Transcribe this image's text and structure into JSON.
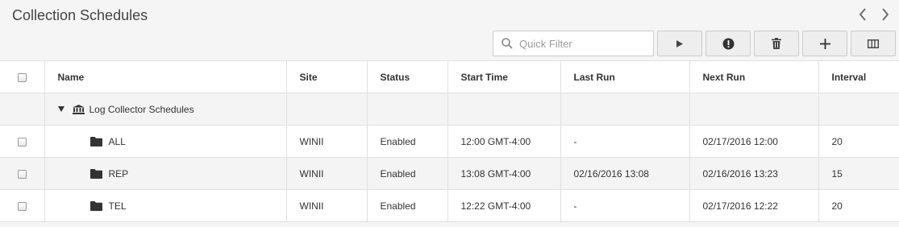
{
  "header": {
    "title": "Collection Schedules"
  },
  "toolbar": {
    "search_placeholder": "Quick Filter"
  },
  "table": {
    "columns": [
      "Name",
      "Site",
      "Status",
      "Start Time",
      "Last Run",
      "Next Run",
      "Interval"
    ],
    "group": {
      "label": "Log Collector Schedules"
    },
    "rows": [
      {
        "name": "ALL",
        "site": "WINII",
        "status": "Enabled",
        "start": "12:00 GMT-4:00",
        "last": "-",
        "next": "02/17/2016 12:00",
        "interval": "20"
      },
      {
        "name": "REP",
        "site": "WINII",
        "status": "Enabled",
        "start": "13:08 GMT-4:00",
        "last": "02/16/2016 13:08",
        "next": "02/16/2016 13:23",
        "interval": "15"
      },
      {
        "name": "TEL",
        "site": "WINII",
        "status": "Enabled",
        "start": "12:22 GMT-4:00",
        "last": "-",
        "next": "02/17/2016 12:22",
        "interval": "20"
      }
    ]
  }
}
